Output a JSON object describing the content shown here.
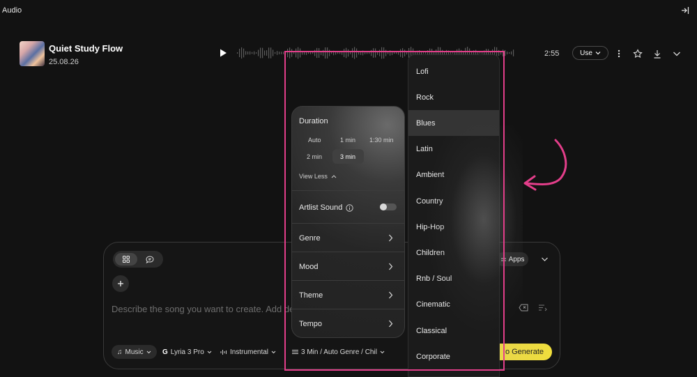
{
  "app": {
    "title": "Audio"
  },
  "track": {
    "title": "Quiet Study Flow",
    "date": "25.08.26",
    "duration": "2:55",
    "use_label": "Use"
  },
  "duration_panel": {
    "heading": "Duration",
    "options": [
      "Auto",
      "1 min",
      "1:30 min",
      "2 min",
      "3 min"
    ],
    "selected": "3 min",
    "view_less": "View Less",
    "artist_sound": "Artlist Sound",
    "artist_sound_enabled": false,
    "menu": [
      "Genre",
      "Mood",
      "Theme",
      "Tempo"
    ]
  },
  "genre_dropdown": {
    "items": [
      "Lofi",
      "Rock",
      "Blues",
      "Latin",
      "Ambient",
      "Country",
      "Hip-Hop",
      "Children",
      "Rnb / Soul",
      "Cinematic",
      "Classical",
      "Corporate"
    ],
    "selected": "Blues"
  },
  "composer": {
    "placeholder": "Describe the song you want to create. Add det",
    "apps_label": "Apps",
    "chips": {
      "music": "Music",
      "model": "Lyria 3 Pro",
      "instrumental": "Instrumental",
      "settings": "3 Min / Auto Genre / Chil"
    },
    "generate_label": "o Generate"
  },
  "colors": {
    "highlight": "#e33e8a",
    "generate": "#f0de3c",
    "background": "#121212"
  }
}
